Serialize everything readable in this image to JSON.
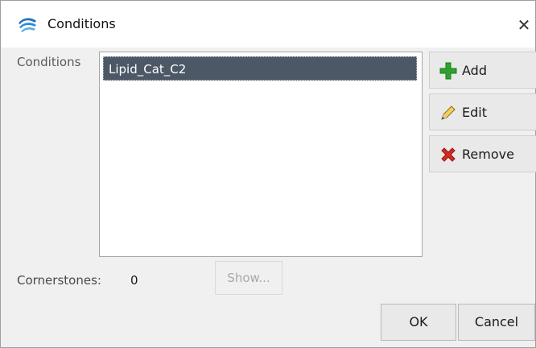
{
  "window": {
    "title": "Conditions",
    "close_glyph": "✕"
  },
  "conditions": {
    "label": "Conditions",
    "items": [
      "Lipid_Cat_C2"
    ],
    "selected_index": 0
  },
  "buttons": {
    "add": {
      "label": "Add",
      "icon": "plus-icon"
    },
    "edit": {
      "label": "Edit",
      "icon": "pencil-icon"
    },
    "remove": {
      "label": "Remove",
      "icon": "x-icon"
    }
  },
  "cornerstones": {
    "label": "Cornerstones:",
    "count": "0",
    "show_label": "Show..."
  },
  "footer": {
    "ok_label": "OK",
    "cancel_label": "Cancel"
  },
  "colors": {
    "selection": "#4c5866",
    "add_icon": "#2ea12e",
    "remove_icon": "#d62b1f"
  }
}
